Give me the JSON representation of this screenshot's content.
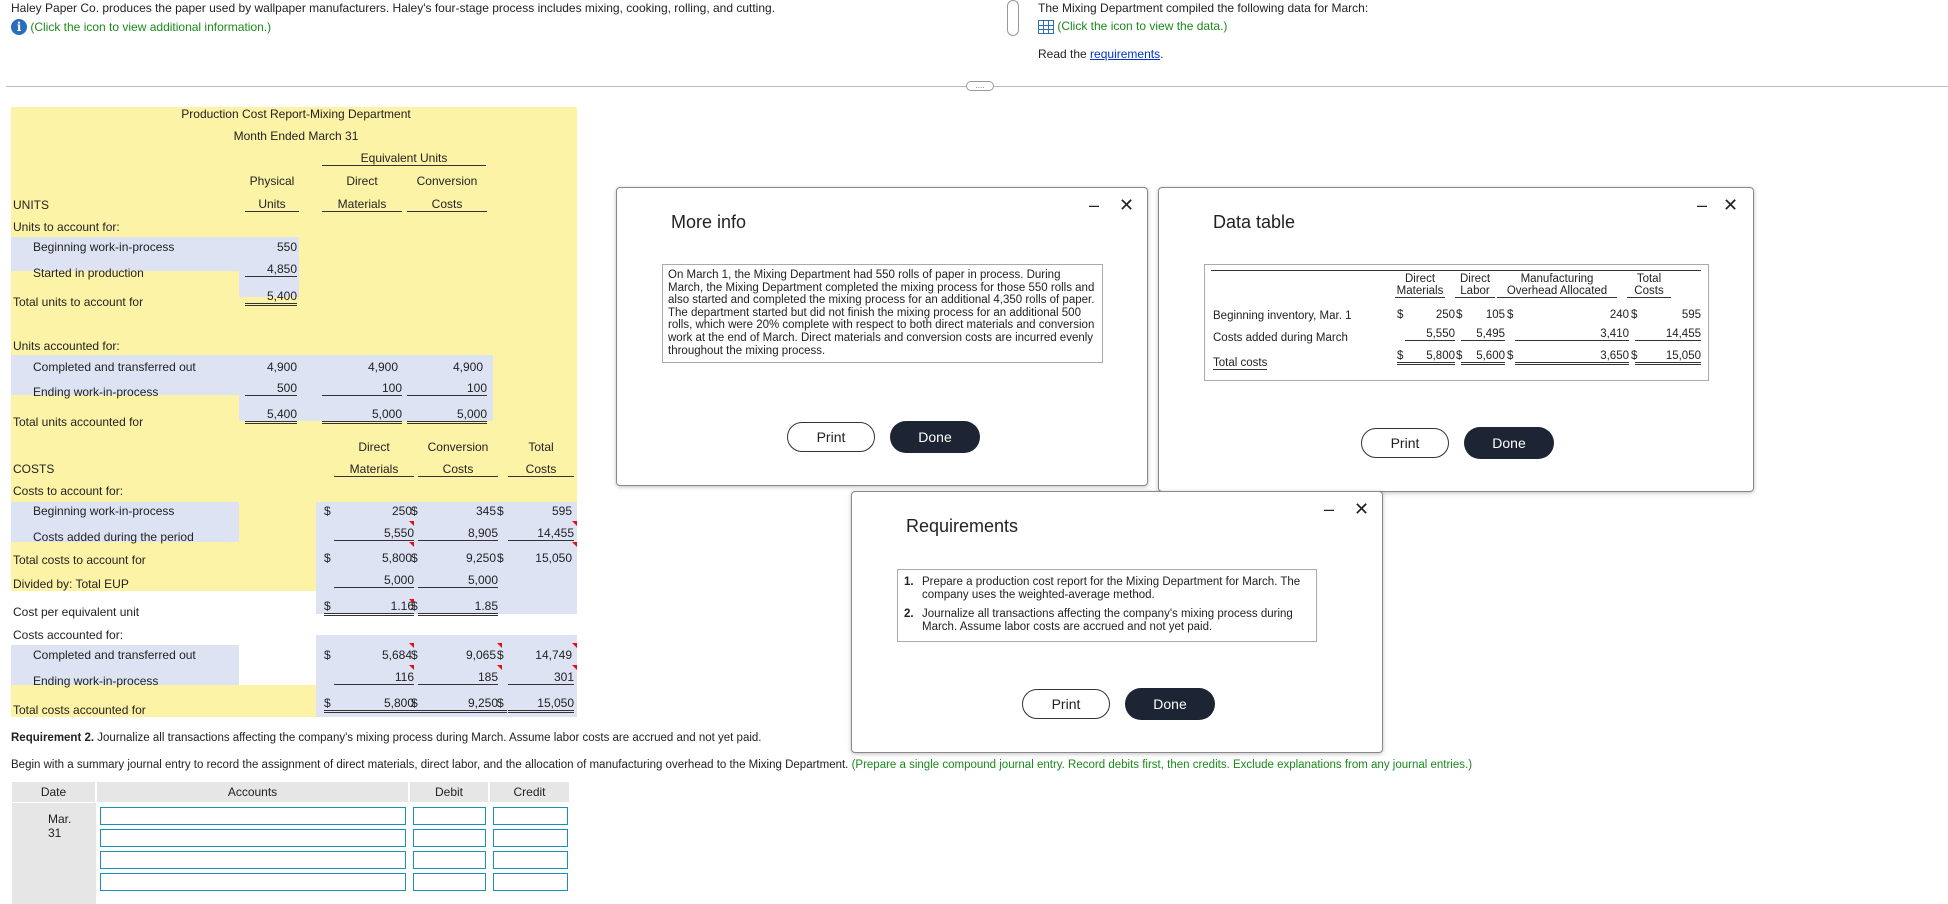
{
  "header": {
    "problem_text": "Haley Paper Co. produces the paper used by wallpaper manufacturers. Haley's four-stage process includes mixing, cooking, rolling, and cutting.",
    "info_link": "(Click the icon to view additional information.)",
    "data_intro": "The Mixing Department compiled the following data for March:",
    "data_link": "(Click the icon to view the data.)",
    "read_the": "Read the",
    "requirements_link": "requirements",
    "period": "."
  },
  "report": {
    "title": "Production Cost Report-Mixing Department",
    "subtitle": "Month Ended March 31",
    "eq_units": "Equivalent Units",
    "h_physical": "Physical",
    "h_units": "Units",
    "h_direct": "Direct",
    "h_materials": "Materials",
    "h_conversion": "Conversion",
    "h_costs": "Costs",
    "h_total": "Total",
    "units_label": "UNITS",
    "units_to_account": "Units to account for:",
    "bwip": "Beginning work-in-process",
    "started": "Started in production",
    "total_units_account": "Total units to account for",
    "units_accounted": "Units accounted for:",
    "completed": "Completed and transferred out",
    "ewip": "Ending work-in-process",
    "total_units_accounted": "Total units accounted for",
    "costs_label": "COSTS",
    "costs_to_account": "Costs to account for:",
    "costs_added": "Costs added during the period",
    "total_costs_account": "Total costs to account for",
    "divided_by": "Divided by: Total EUP",
    "cost_per_eu": "Cost per equivalent unit",
    "costs_accounted": "Costs accounted for:",
    "total_costs_accounted": "Total costs accounted for",
    "dollar": "$",
    "v": {
      "phys_bwip": "550",
      "phys_started": "4,850",
      "phys_total": "5,400",
      "phys_completed": "4,900",
      "phys_ewip": "500",
      "phys_total2": "5,400",
      "dm_completed": "4,900",
      "dm_ewip": "100",
      "dm_total": "5,000",
      "cc_completed": "4,900",
      "cc_ewip": "100",
      "cc_total": "5,000",
      "dm_bwip_cost": "250",
      "cc_bwip_cost": "345",
      "tot_bwip_cost": "595",
      "dm_added": "5,550",
      "cc_added": "8,905",
      "tot_added": "14,455",
      "dm_total_cost": "5,800",
      "cc_total_cost": "9,250",
      "tot_total_cost": "15,050",
      "dm_eup": "5,000",
      "cc_eup": "5,000",
      "dm_per": "1.16",
      "cc_per": "1.85",
      "dm_comp_cost": "5,684",
      "cc_comp_cost": "9,065",
      "tot_comp_cost": "14,749",
      "dm_ewip_cost": "116",
      "cc_ewip_cost": "185",
      "tot_ewip_cost": "301",
      "dm_final": "5,800",
      "cc_final": "9,250",
      "tot_final": "15,050"
    }
  },
  "req2": {
    "heading_bold": "Requirement 2.",
    "heading_rest": " Journalize all transactions affecting the company's mixing process during March. Assume labor costs are accrued and not yet paid.",
    "instr": "Begin with a summary journal entry to record the assignment of direct materials, direct labor, and the allocation of manufacturing overhead to the Mixing Department.",
    "instr_green": " (Prepare a single compound journal entry. Record debits first, then credits. Exclude explanations from any journal entries.)"
  },
  "journal": {
    "h_date": "Date",
    "h_accounts": "Accounts",
    "h_debit": "Debit",
    "h_credit": "Credit",
    "date": "Mar. 31"
  },
  "more_info": {
    "title": "More info",
    "text": "On March 1, the Mixing Department had 550 rolls of paper in process. During March, the Mixing Department completed the mixing process for those 550 rolls and also started and completed the mixing process for an additional 4,350 rolls of paper. The department started but did not finish the mixing process for an additional 500 rolls, which were 20% complete with respect to both direct materials and conversion work at the end of March. Direct materials and conversion costs are incurred evenly throughout the mixing process.",
    "print": "Print",
    "done": "Done"
  },
  "data_table": {
    "title": "Data table",
    "h_dm1": "Direct",
    "h_dm2": "Materials",
    "h_dl1": "Direct",
    "h_dl2": "Labor",
    "h_mo1": "Manufacturing",
    "h_mo2": "Overhead Allocated",
    "h_tc1": "Total",
    "h_tc2": "Costs",
    "row1": "Beginning inventory, Mar. 1",
    "row2": "Costs added during March",
    "row3": "Total costs",
    "dollar": "$",
    "r1": [
      "250",
      "105",
      "240",
      "595"
    ],
    "r2": [
      "5,550",
      "5,495",
      "3,410",
      "14,455"
    ],
    "r3": [
      "5,800",
      "5,600",
      "3,650",
      "15,050"
    ],
    "print": "Print",
    "done": "Done"
  },
  "requirements": {
    "title": "Requirements",
    "items": [
      "Prepare a production cost report for the Mixing Department for March. The company uses the weighted-average method.",
      "Journalize all transactions affecting the company's mixing process during March. Assume labor costs are accrued and not yet paid."
    ],
    "n1": "1.",
    "n2": "2.",
    "print": "Print",
    "done": "Done"
  },
  "icons": {
    "minimize": "minimize-icon",
    "close": "close-icon",
    "info": "info-icon",
    "table": "table-icon"
  },
  "colors": {
    "report_yellow": "#fdf3a6",
    "report_blue": "#dde3f3",
    "dark_button": "#1d2433",
    "instruction_green": "#1a8a1a"
  }
}
